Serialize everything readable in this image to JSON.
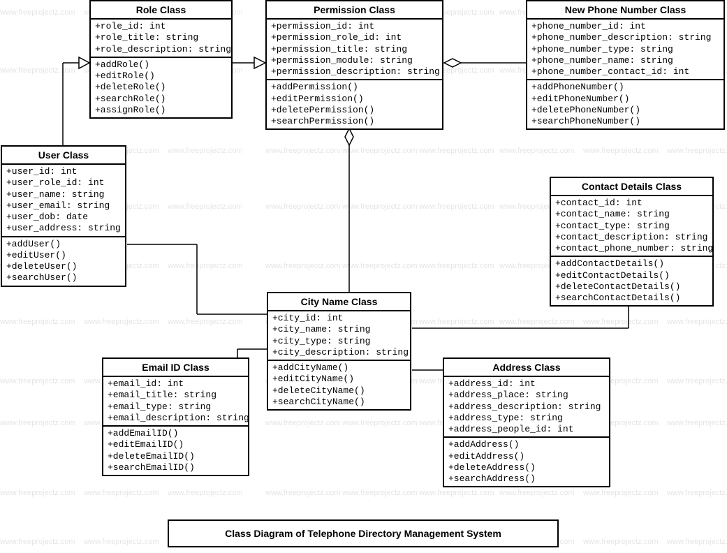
{
  "title": "Class Diagram of Telephone Directory Management System",
  "watermark": "www.freeprojectz.com",
  "classes": {
    "role": {
      "name": "Role Class",
      "attrs": [
        "+role_id: int",
        "+role_title: string",
        "+role_description: string"
      ],
      "ops": [
        "+addRole()",
        "+editRole()",
        "+deleteRole()",
        "+searchRole()",
        "+assignRole()"
      ]
    },
    "permission": {
      "name": "Permission Class",
      "attrs": [
        "+permission_id: int",
        "+permission_role_id: int",
        "+permission_title: string",
        "+permission_module: string",
        "+permission_description: string"
      ],
      "ops": [
        "+addPermission()",
        "+editPermission()",
        "+deletePermission()",
        "+searchPermission()"
      ]
    },
    "phone": {
      "name": "New Phone Number Class",
      "attrs": [
        "+phone_number_id: int",
        "+phone_number_description: string",
        "+phone_number_type: string",
        "+phone_number_name: string",
        "+phone_number_contact_id: int"
      ],
      "ops": [
        "+addPhoneNumber()",
        "+editPhoneNumber()",
        "+deletePhoneNumber()",
        "+searchPhoneNumber()"
      ]
    },
    "user": {
      "name": "User Class",
      "attrs": [
        "+user_id: int",
        "+user_role_id: int",
        "+user_name: string",
        "+user_email: string",
        "+user_dob: date",
        "+user_address: string"
      ],
      "ops": [
        "+addUser()",
        "+editUser()",
        "+deleteUser()",
        "+searchUser()"
      ]
    },
    "contact": {
      "name": "Contact Details Class",
      "attrs": [
        "+contact_id: int",
        "+contact_name: string",
        "+contact_type: string",
        "+contact_description: string",
        "+contact_phone_number: string"
      ],
      "ops": [
        "+addContactDetails()",
        "+editContactDetails()",
        "+deleteContactDetails()",
        "+searchContactDetails()"
      ]
    },
    "city": {
      "name": "City Name Class",
      "attrs": [
        "+city_id: int",
        "+city_name: string",
        "+city_type: string",
        "+city_description: string"
      ],
      "ops": [
        "+addCityName()",
        "+editCityName()",
        "+deleteCityName()",
        "+searchCityName()"
      ]
    },
    "email": {
      "name": "Email ID Class",
      "attrs": [
        "+email_id: int",
        "+email_title: string",
        "+email_type: string",
        "+email_description: string"
      ],
      "ops": [
        "+addEmailID()",
        "+editEmailID()",
        "+deleteEmailID()",
        "+searchEmailID()"
      ]
    },
    "address": {
      "name": "Address Class",
      "attrs": [
        "+address_id: int",
        "+address_place: string",
        "+address_description: string",
        "+address_type: string",
        "+address_people_id: int"
      ],
      "ops": [
        "+addAddress()",
        "+editAddress()",
        "+deleteAddress()",
        "+searchAddress()"
      ]
    }
  }
}
